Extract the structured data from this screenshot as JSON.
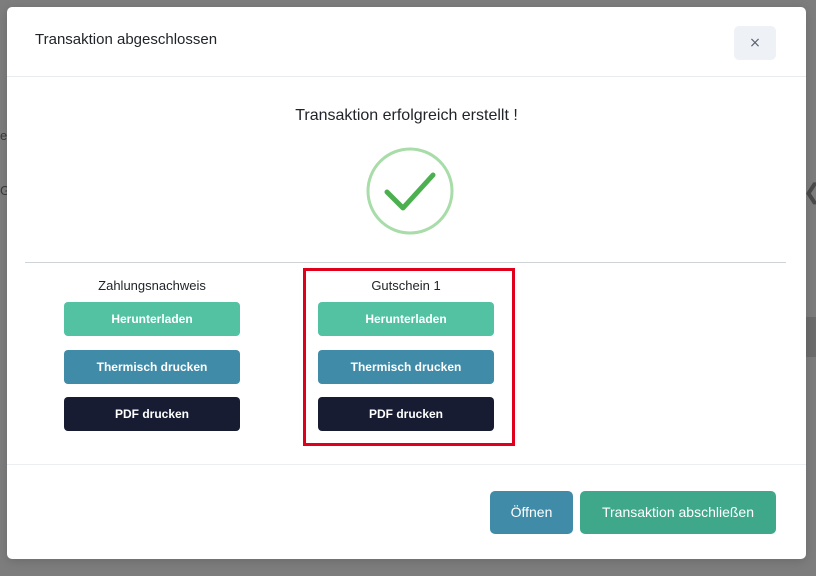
{
  "modal": {
    "title": "Transaktion abgeschlossen",
    "close_label": "×",
    "success_message": "Transaktion erfolgreich erstellt !",
    "success_icon": "checkmark-circle-icon"
  },
  "columns": [
    {
      "label": "Zahlungsnachweis",
      "download_label": "Herunterladen",
      "thermal_label": "Thermisch drucken",
      "pdf_label": "PDF drucken"
    },
    {
      "label": "Gutschein 1",
      "download_label": "Herunterladen",
      "thermal_label": "Thermisch drucken",
      "pdf_label": "PDF drucken"
    }
  ],
  "footer": {
    "open_label": "Öffnen",
    "finish_label": "Transaktion abschließen"
  },
  "colors": {
    "download": "#52c2a3",
    "thermal": "#3f8ba8",
    "pdf": "#181c33",
    "open": "#3f8ba8",
    "finish": "#3fa88b",
    "check_ring": "#a8dca8",
    "check_mark": "#4caf50",
    "highlight": "#e0001b"
  }
}
